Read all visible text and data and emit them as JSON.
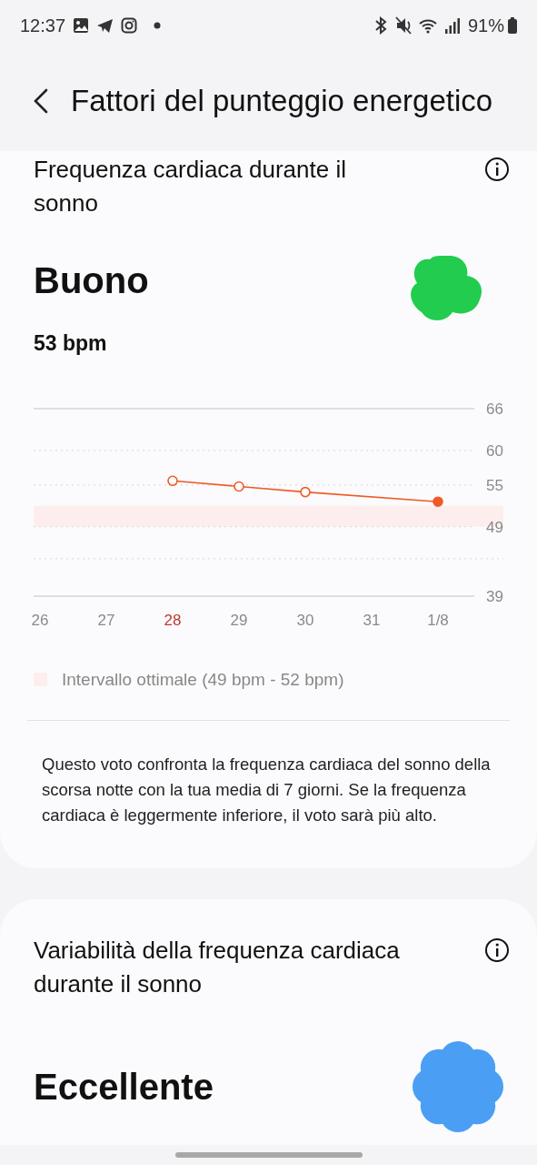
{
  "status_bar": {
    "time": "12:37",
    "battery": "91%"
  },
  "header": {
    "title": "Fattori del punteggio energetico"
  },
  "sections": [
    {
      "title": "Frequenza cardiaca durante il sonno",
      "rating": "Buono",
      "value": "53 bpm",
      "color": "#22cc4e",
      "day_marks": [
        {
          "highlighted": false
        },
        {
          "highlighted": false
        },
        {
          "highlighted": true,
          "latest": false
        },
        {
          "highlighted": false,
          "latest": false
        },
        {
          "highlighted": false,
          "latest": false
        },
        {
          "highlighted": false
        },
        {
          "highlighted": false,
          "latest": true
        }
      ],
      "chart_data": {
        "type": "line",
        "categories": [
          "26",
          "27",
          "28",
          "29",
          "30",
          "31",
          "1/8"
        ],
        "series": [
          {
            "color": "#f05a28",
            "marker": "o",
            "values": [
              null,
              null,
              55.6,
              54.8,
              54,
              null,
              52.6
            ]
          }
        ],
        "grid": true,
        "ylim": [
          39,
          66
        ],
        "yticks": [
          66,
          60,
          55,
          49,
          39
        ],
        "bands": [
          {
            "axis": "y",
            "from": 49,
            "to": 52,
            "color": "#fdeeed",
            "label": "Intervallo ottimale (49 bpm - 52 bpm)"
          }
        ]
      },
      "description": "Questo voto confronta la frequenza cardiaca del sonno della scorsa notte con la tua media di 7 giorni. Se la frequenza cardiaca è leggermente inferiore, il voto sarà più alto."
    },
    {
      "title": "Variabilità della frequenza cardiaca durante il sonno",
      "rating": "Eccellente",
      "color": "#4a9ff5"
    }
  ]
}
